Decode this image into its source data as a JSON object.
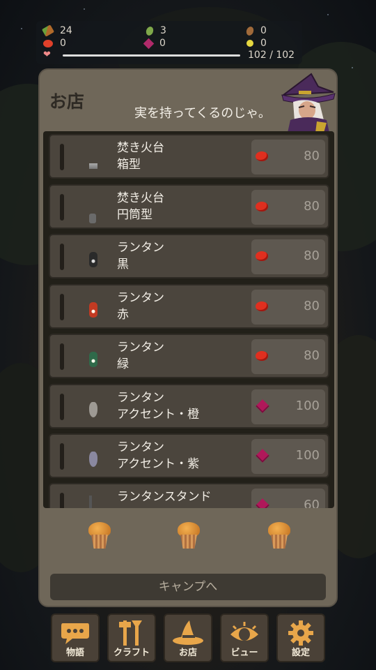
{
  "resources": {
    "wood": "24",
    "bean": "3",
    "nut": "0",
    "red_berry": "0",
    "gem": "0",
    "yellow": "0"
  },
  "hp": {
    "current": "102",
    "separator": "/",
    "max": "102",
    "fill_fraction": 1.0
  },
  "shop": {
    "title": "お店",
    "speech": "実を持ってくるのじゃ。",
    "items": [
      {
        "line1": "焚き火台",
        "line2": "箱型",
        "currency": "red-berry-icon",
        "price": "80"
      },
      {
        "line1": "焚き火台",
        "line2": "円筒型",
        "currency": "red-berry-icon",
        "price": "80"
      },
      {
        "line1": "ランタン",
        "line2": "黒",
        "currency": "red-berry-icon",
        "price": "80"
      },
      {
        "line1": "ランタン",
        "line2": "赤",
        "currency": "red-berry-icon",
        "price": "80"
      },
      {
        "line1": "ランタン",
        "line2": "緑",
        "currency": "red-berry-icon",
        "price": "80"
      },
      {
        "line1": "ランタン",
        "line2": "アクセント・橙",
        "currency": "gem-icon",
        "price": "100"
      },
      {
        "line1": "ランタン",
        "line2": "アクセント・紫",
        "currency": "gem-icon",
        "price": "100"
      },
      {
        "line1": "ランタンスタンド",
        "line2": "",
        "currency": "gem-icon",
        "price": "60"
      }
    ],
    "camp_button": "キャンプへ"
  },
  "nav": {
    "story": "物語",
    "craft": "クラフト",
    "shop": "お店",
    "view": "ビュー",
    "settings": "設定"
  },
  "colors": {
    "panel": "#6f6759",
    "list_bg": "#222019",
    "item_bg": "#4b453d",
    "red_currency": "#e02f1f",
    "gem_currency": "#b0185a"
  }
}
